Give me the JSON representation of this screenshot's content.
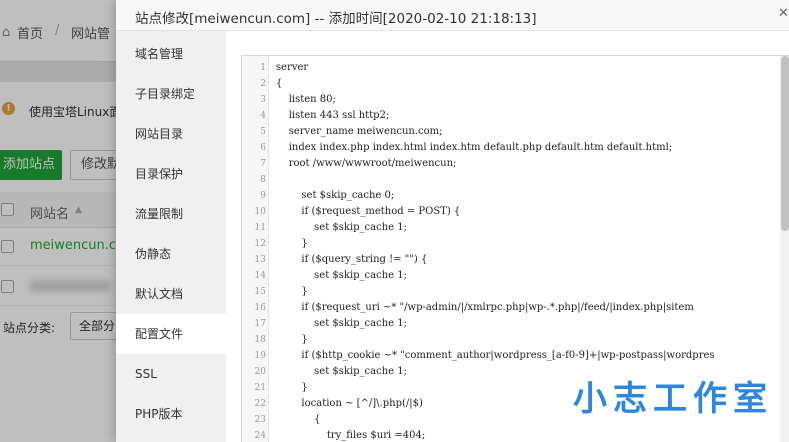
{
  "background": {
    "breadcrumb": {
      "home": "首页",
      "separator": "/",
      "current": "网站管"
    },
    "warning": {
      "icon": "warning-icon",
      "text": "使用宝塔Linux面"
    },
    "toolbar": {
      "add_site": "添加站点",
      "modify": "修改默"
    },
    "table": {
      "header_sitename": "网站名",
      "rows": [
        {
          "site": "meiwencun.com"
        }
      ]
    },
    "category": {
      "label": "站点分类:",
      "selected": "全部分"
    }
  },
  "modal": {
    "title": "站点修改[meiwencun.com] -- 添加时间[2020-02-10 21:18:13]",
    "close_icon": "close-icon",
    "nav": [
      {
        "label": "域名管理",
        "active": false
      },
      {
        "label": "子目录绑定",
        "active": false
      },
      {
        "label": "网站目录",
        "active": false
      },
      {
        "label": "目录保护",
        "active": false
      },
      {
        "label": "流量限制",
        "active": false
      },
      {
        "label": "伪静态",
        "active": false
      },
      {
        "label": "默认文档",
        "active": false
      },
      {
        "label": "配置文件",
        "active": true
      },
      {
        "label": "SSL",
        "active": false
      },
      {
        "label": "PHP版本",
        "active": false
      }
    ],
    "editor": {
      "lines": [
        {
          "n": "1",
          "text": "server"
        },
        {
          "n": "2",
          "text": "{"
        },
        {
          "n": "3",
          "text": "    listen 80;"
        },
        {
          "n": "4",
          "text": "    listen 443 ssl http2;"
        },
        {
          "n": "5",
          "text": "    server_name meiwencun.com;"
        },
        {
          "n": "6",
          "text": "    index index.php index.html index.htm default.php default.htm default.html;"
        },
        {
          "n": "7",
          "text": "    root /www/wwwroot/meiwencun;"
        },
        {
          "n": "8",
          "text": ""
        },
        {
          "n": "9",
          "text": "        set $skip_cache 0;"
        },
        {
          "n": "10",
          "text": "        if ($request_method = POST) {"
        },
        {
          "n": "11",
          "text": "            set $skip_cache 1;"
        },
        {
          "n": "12",
          "text": "        }"
        },
        {
          "n": "13",
          "text": "        if ($query_string != \"\") {"
        },
        {
          "n": "14",
          "text": "            set $skip_cache 1;"
        },
        {
          "n": "15",
          "text": "        }"
        },
        {
          "n": "16",
          "text": "        if ($request_uri ~* \"/wp-admin/|/xmlrpc.php|wp-.*.php|/feed/|index.php|sitem"
        },
        {
          "n": "17",
          "text": "            set $skip_cache 1;"
        },
        {
          "n": "18",
          "text": "        }"
        },
        {
          "n": "19",
          "text": "        if ($http_cookie ~* \"comment_author|wordpress_[a-f0-9]+|wp-postpass|wordpres"
        },
        {
          "n": "20",
          "text": "            set $skip_cache 1;"
        },
        {
          "n": "21",
          "text": "        }"
        },
        {
          "n": "22",
          "text": "        location ~ [^/]\\.php(/|$)"
        },
        {
          "n": "23",
          "text": "            {"
        },
        {
          "n": "24",
          "text": "                try_files $uri =404;"
        }
      ]
    }
  },
  "watermark": "小志工作室"
}
